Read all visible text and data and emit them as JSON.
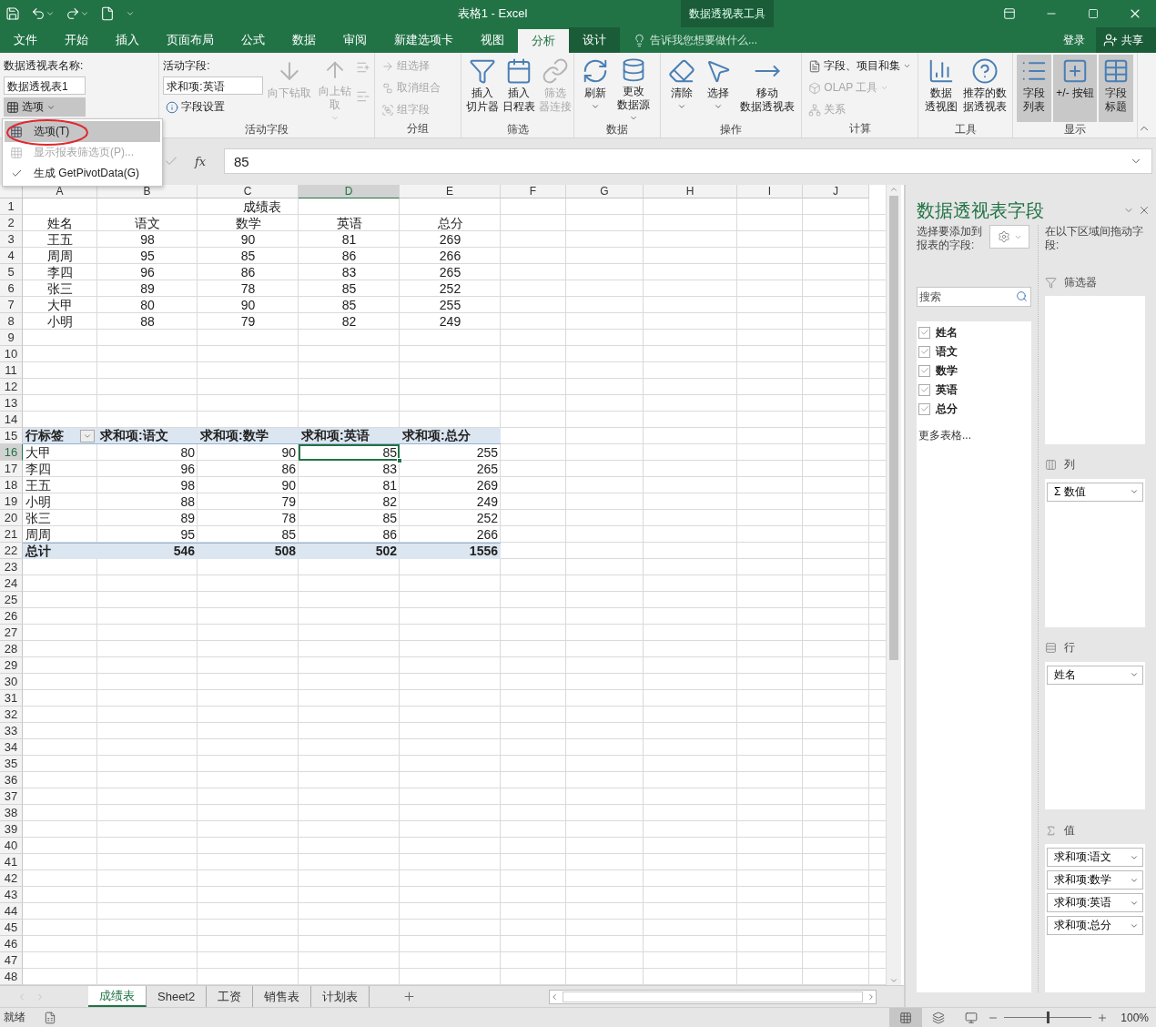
{
  "window": {
    "title": "表格1 - Excel",
    "context_group": "数据透视表工具"
  },
  "ribbon_tabs": [
    {
      "label": "文件",
      "selected": false,
      "contextual": false
    },
    {
      "label": "开始",
      "selected": false,
      "contextual": false
    },
    {
      "label": "插入",
      "selected": false,
      "contextual": false
    },
    {
      "label": "页面布局",
      "selected": false,
      "contextual": false
    },
    {
      "label": "公式",
      "selected": false,
      "contextual": false
    },
    {
      "label": "数据",
      "selected": false,
      "contextual": false
    },
    {
      "label": "审阅",
      "selected": false,
      "contextual": false
    },
    {
      "label": "新建选项卡",
      "selected": false,
      "contextual": false
    },
    {
      "label": "视图",
      "selected": false,
      "contextual": false
    },
    {
      "label": "分析",
      "selected": true,
      "contextual": true
    },
    {
      "label": "设计",
      "selected": false,
      "contextual": true
    }
  ],
  "tell_me": {
    "placeholder": "告诉我您想要做什么..."
  },
  "account": {
    "sign_in": "登录",
    "share": "共享"
  },
  "ribbon": {
    "pivot_table": {
      "name_label": "数据透视表名称:",
      "name": "数据透视表1",
      "options": {
        "label": "选项",
        "expanded": true
      }
    },
    "active_field": {
      "field_label": "活动字段:",
      "field": "求和项:英语",
      "settings": "字段设置",
      "drill_down": {
        "label": "向下钻取",
        "disabled": true
      },
      "drill_up": {
        "label": "向上钻取",
        "disabled": true
      },
      "group_label": "活动字段"
    },
    "grouping": {
      "items": [
        {
          "label": "组选择",
          "disabled": true
        },
        {
          "label": "取消组合",
          "disabled": true
        },
        {
          "label": "组字段",
          "disabled": true
        }
      ],
      "group_label": "分组"
    },
    "filter": {
      "items": [
        {
          "label": "插入切片器",
          "disabled": false
        },
        {
          "label": "插入日程表",
          "disabled": false
        },
        {
          "label": "筛选器连接",
          "disabled": true
        }
      ],
      "group_label": "筛选"
    },
    "data": {
      "items": [
        {
          "label": "刷新",
          "caret": true
        },
        {
          "label": "更改数据源",
          "caret": true
        }
      ],
      "group_label": "数据"
    },
    "actions": {
      "items": [
        {
          "label": "清除",
          "caret": true
        },
        {
          "label": "选择",
          "caret": true
        },
        {
          "label": "移动数据透视表",
          "caret": false
        }
      ],
      "group_label": "操作"
    },
    "calculations": {
      "items": [
        {
          "label": "字段、项目和集",
          "disabled": false,
          "caret": true
        },
        {
          "label": "OLAP 工具",
          "disabled": true,
          "caret": true
        },
        {
          "label": "关系",
          "disabled": true,
          "caret": false
        }
      ],
      "group_label": "计算"
    },
    "tools": {
      "items": [
        {
          "label": "数据透视图"
        },
        {
          "label": "推荐的数据透视表"
        }
      ],
      "group_label": "工具"
    },
    "show": {
      "items": [
        {
          "label": "字段列表",
          "on": true
        },
        {
          "label": "+/- 按钮",
          "on": true
        },
        {
          "label": "字段标题",
          "on": true
        }
      ],
      "group_label": "显示"
    }
  },
  "options_menu": {
    "items": [
      {
        "label": "选项(T)",
        "selected": true,
        "disabled": false,
        "checked": false,
        "circled": true
      },
      {
        "label": "显示报表筛选页(P)...",
        "selected": false,
        "disabled": true,
        "checked": false,
        "circled": false
      },
      {
        "label": "生成 GetPivotData(G)",
        "selected": false,
        "disabled": false,
        "checked": true,
        "circled": false
      }
    ]
  },
  "formula_bar": {
    "function_label": "fx",
    "value": "85"
  },
  "sheet": {
    "columns": [
      {
        "label": "A",
        "selected": false
      },
      {
        "label": "B",
        "selected": false
      },
      {
        "label": "C",
        "selected": false
      },
      {
        "label": "D",
        "selected": true
      },
      {
        "label": "E",
        "selected": false
      },
      {
        "label": "F",
        "selected": false
      },
      {
        "label": "G",
        "selected": false
      },
      {
        "label": "H",
        "selected": false
      },
      {
        "label": "I",
        "selected": false
      },
      {
        "label": "J",
        "selected": false
      }
    ],
    "rows": [
      {
        "number": "1",
        "selected": false,
        "kind": "title",
        "text": "成绩表"
      },
      {
        "number": "2",
        "selected": false,
        "kind": "table",
        "cells": {
          "A": "姓名",
          "B": "语文",
          "C": "数学",
          "D": "英语",
          "E": "总分"
        }
      },
      {
        "number": "3",
        "selected": false,
        "kind": "table",
        "cells": {
          "A": "王五",
          "B": "98",
          "C": "90",
          "D": "81",
          "E": "269"
        }
      },
      {
        "number": "4",
        "selected": false,
        "kind": "table",
        "cells": {
          "A": "周周",
          "B": "95",
          "C": "85",
          "D": "86",
          "E": "266"
        }
      },
      {
        "number": "5",
        "selected": false,
        "kind": "table",
        "cells": {
          "A": "李四",
          "B": "96",
          "C": "86",
          "D": "83",
          "E": "265"
        }
      },
      {
        "number": "6",
        "selected": false,
        "kind": "table",
        "cells": {
          "A": "张三",
          "B": "89",
          "C": "78",
          "D": "85",
          "E": "252"
        }
      },
      {
        "number": "7",
        "selected": false,
        "kind": "table",
        "cells": {
          "A": "大甲",
          "B": "80",
          "C": "90",
          "D": "85",
          "E": "255"
        }
      },
      {
        "number": "8",
        "selected": false,
        "kind": "table",
        "cells": {
          "A": "小明",
          "B": "88",
          "C": "79",
          "D": "82",
          "E": "249"
        }
      },
      {
        "number": "9",
        "selected": false,
        "kind": "blank"
      },
      {
        "number": "10",
        "selected": false,
        "kind": "blank"
      },
      {
        "number": "11",
        "selected": false,
        "kind": "blank"
      },
      {
        "number": "12",
        "selected": false,
        "kind": "blank"
      },
      {
        "number": "13",
        "selected": false,
        "kind": "blank"
      },
      {
        "number": "14",
        "selected": false,
        "kind": "blank"
      },
      {
        "number": "15",
        "selected": false,
        "kind": "pivot_header",
        "cells": {
          "A": "行标签",
          "B": "求和项:语文",
          "C": "求和项:数学",
          "D": "求和项:英语",
          "E": "求和项:总分"
        }
      },
      {
        "number": "16",
        "selected": true,
        "kind": "pivot_row",
        "cells": {
          "A": "大甲",
          "B": "80",
          "C": "90",
          "D": "85",
          "E": "255"
        }
      },
      {
        "number": "17",
        "selected": false,
        "kind": "pivot_row",
        "cells": {
          "A": "李四",
          "B": "96",
          "C": "86",
          "D": "83",
          "E": "265"
        }
      },
      {
        "number": "18",
        "selected": false,
        "kind": "pivot_row",
        "cells": {
          "A": "王五",
          "B": "98",
          "C": "90",
          "D": "81",
          "E": "269"
        }
      },
      {
        "number": "19",
        "selected": false,
        "kind": "pivot_row",
        "cells": {
          "A": "小明",
          "B": "88",
          "C": "79",
          "D": "82",
          "E": "249"
        }
      },
      {
        "number": "20",
        "selected": false,
        "kind": "pivot_row",
        "cells": {
          "A": "张三",
          "B": "89",
          "C": "78",
          "D": "85",
          "E": "252"
        }
      },
      {
        "number": "21",
        "selected": false,
        "kind": "pivot_row",
        "cells": {
          "A": "周周",
          "B": "95",
          "C": "85",
          "D": "86",
          "E": "266"
        }
      },
      {
        "number": "22",
        "selected": false,
        "kind": "pivot_total",
        "cells": {
          "A": "总计",
          "B": "546",
          "C": "508",
          "D": "502",
          "E": "1556"
        }
      },
      {
        "number": "23",
        "selected": false,
        "kind": "blank"
      },
      {
        "number": "24",
        "selected": false,
        "kind": "blank"
      },
      {
        "number": "25",
        "selected": false,
        "kind": "blank"
      },
      {
        "number": "26",
        "selected": false,
        "kind": "blank"
      },
      {
        "number": "27",
        "selected": false,
        "kind": "blank"
      },
      {
        "number": "28",
        "selected": false,
        "kind": "blank"
      },
      {
        "number": "29",
        "selected": false,
        "kind": "blank"
      },
      {
        "number": "30",
        "selected": false,
        "kind": "blank"
      },
      {
        "number": "31",
        "selected": false,
        "kind": "blank"
      },
      {
        "number": "32",
        "selected": false,
        "kind": "blank"
      },
      {
        "number": "33",
        "selected": false,
        "kind": "blank"
      },
      {
        "number": "34",
        "selected": false,
        "kind": "blank"
      },
      {
        "number": "35",
        "selected": false,
        "kind": "blank"
      },
      {
        "number": "36",
        "selected": false,
        "kind": "blank"
      },
      {
        "number": "37",
        "selected": false,
        "kind": "blank"
      },
      {
        "number": "38",
        "selected": false,
        "kind": "blank"
      },
      {
        "number": "39",
        "selected": false,
        "kind": "blank"
      },
      {
        "number": "40",
        "selected": false,
        "kind": "blank"
      },
      {
        "number": "41",
        "selected": false,
        "kind": "blank"
      },
      {
        "number": "42",
        "selected": false,
        "kind": "blank"
      },
      {
        "number": "43",
        "selected": false,
        "kind": "blank"
      },
      {
        "number": "44",
        "selected": false,
        "kind": "blank"
      },
      {
        "number": "45",
        "selected": false,
        "kind": "blank"
      },
      {
        "number": "46",
        "selected": false,
        "kind": "blank"
      },
      {
        "number": "47",
        "selected": false,
        "kind": "blank"
      },
      {
        "number": "48",
        "selected": false,
        "kind": "blank"
      }
    ]
  },
  "sheet_tabs": [
    {
      "label": "成绩表",
      "selected": true
    },
    {
      "label": "Sheet2",
      "selected": false
    },
    {
      "label": "工资",
      "selected": false
    },
    {
      "label": "销售表",
      "selected": false
    },
    {
      "label": "计划表",
      "selected": false
    }
  ],
  "field_pane": {
    "title": "数据透视表字段",
    "instruction": "选择要添加到报表的字段:",
    "search": {
      "placeholder": "搜索"
    },
    "fields": [
      {
        "label": "姓名",
        "checked": true
      },
      {
        "label": "语文",
        "checked": true
      },
      {
        "label": "数学",
        "checked": true
      },
      {
        "label": "英语",
        "checked": true
      },
      {
        "label": "总分",
        "checked": true
      }
    ],
    "more_tables": "更多表格...",
    "drag_hint": "在以下区域间拖动字段:",
    "areas": [
      {
        "kind": "filters",
        "label": "筛选器"
      },
      {
        "kind": "columns",
        "label": "列",
        "items": [
          "Σ 数值"
        ]
      },
      {
        "kind": "rows",
        "label": "行",
        "items": [
          "姓名"
        ]
      },
      {
        "kind": "values",
        "label": "值",
        "items": [
          "求和项:语文",
          "求和项:数学",
          "求和项:英语",
          "求和项:总分"
        ]
      }
    ]
  },
  "status_bar": {
    "text": "就绪",
    "zoom": {
      "level": 0.5,
      "reading": "100%"
    }
  }
}
